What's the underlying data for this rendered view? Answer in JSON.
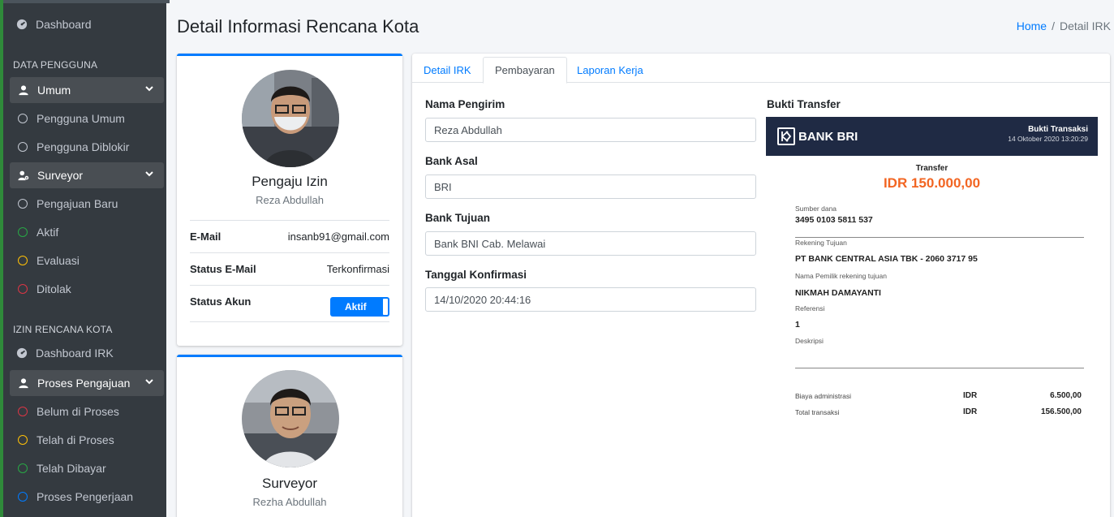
{
  "sidebar": {
    "dashboard": "Dashboard",
    "header_users": "DATA PENGGUNA",
    "umum": "Umum",
    "pengguna_umum": "Pengguna Umum",
    "pengguna_diblokir": "Pengguna Diblokir",
    "surveyor": "Surveyor",
    "pengajuan_baru": "Pengajuan Baru",
    "aktif": "Aktif",
    "evaluasi": "Evaluasi",
    "ditolak": "Ditolak",
    "header_irk": "IZIN RENCANA KOTA",
    "dashboard_irk": "Dashboard IRK",
    "proses_pengajuan": "Proses Pengajuan",
    "belum_di_proses": "Belum di Proses",
    "telah_di_proses": "Telah di Proses",
    "telah_dibayar": "Telah Dibayar",
    "proses_pengerjaan": "Proses Pengerjaan"
  },
  "header": {
    "title": "Detail Informasi Rencana Kota",
    "breadcrumb_home": "Home",
    "breadcrumb_sep": "/",
    "breadcrumb_current": "Detail IRK"
  },
  "profile": {
    "role": "Pengaju Izin",
    "name": "Reza Abdullah",
    "email_label": "E-Mail",
    "email_value": "insanb91@gmail.com",
    "email_status_label": "Status E-Mail",
    "email_status_value": "Terkonfirmasi",
    "account_status_label": "Status Akun",
    "account_status_value": "Aktif"
  },
  "surveyor": {
    "role": "Surveyor",
    "name": "Rezha Abdullah"
  },
  "tabs": [
    "Detail IRK",
    "Pembayaran",
    "Laporan Kerja"
  ],
  "payment": {
    "sender_label": "Nama Pengirim",
    "sender_value": "Reza Abdullah",
    "origin_bank_label": "Bank Asal",
    "origin_bank_value": "BRI",
    "dest_bank_label": "Bank Tujuan",
    "dest_bank_value": "Bank BNI Cab. Melawai",
    "confirm_date_label": "Tanggal Konfirmasi",
    "confirm_date_value": "14/10/2020 20:44:16",
    "proof_label": "Bukti Transfer"
  },
  "receipt": {
    "bank_name": "BANK BRI",
    "header_title": "Bukti Transaksi",
    "header_date": "14 Oktober 2020 13:20:29",
    "transfer_label": "Transfer",
    "amount": "IDR 150.000,00",
    "source_label": "Sumber dana",
    "source_value": "3495 0103 5811 537",
    "dest_label": "Rekening Tujuan",
    "dest_value": "PT BANK CENTRAL ASIA TBK - 2060 3717 95",
    "owner_label": "Nama Pemilik rekening tujuan",
    "owner_value": "NIKMAH DAMAYANTI",
    "ref_label": "Referensi",
    "ref_value": "1",
    "desc_label": "Deskripsi",
    "fee_label": "Biaya administrasi",
    "fee_currency": "IDR",
    "fee_value": "6.500,00",
    "total_label": "Total transaksi",
    "total_currency": "IDR",
    "total_value": "156.500,00"
  },
  "colors": {
    "sidebar_bg": "#343a40",
    "primary": "#007bff",
    "amount_orange": "#f26522",
    "receipt_header": "#1f2a44"
  }
}
